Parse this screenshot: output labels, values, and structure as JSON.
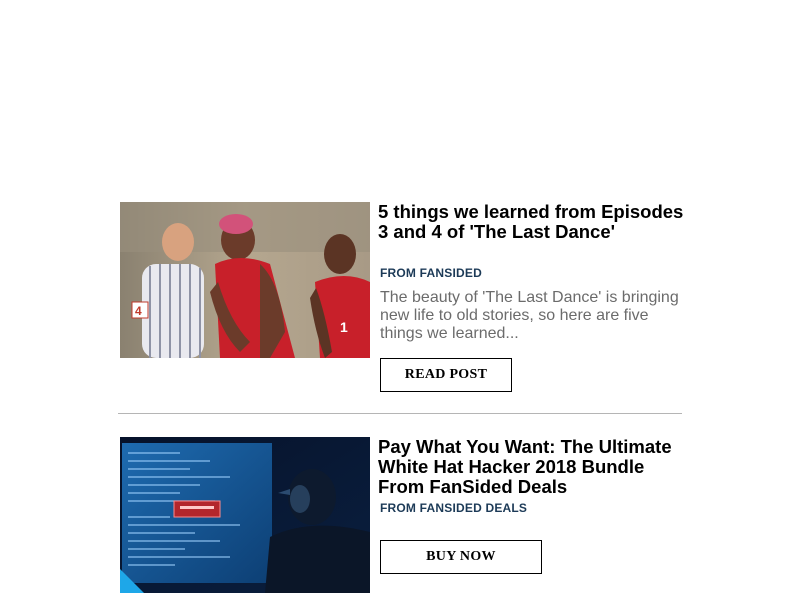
{
  "articles": [
    {
      "title": "5 things we learned from Episodes 3 and 4 of 'The Last Dance'",
      "source": "FROM FANSIDED",
      "excerpt": "The beauty of 'The Last Dance' is bringing new life to old stories, so here are five things we learned...",
      "cta_label": "READ POST",
      "image_alt": "basketball-players-photo"
    },
    {
      "title": "Pay What You Want: The Ultimate White Hat Hacker 2018 Bundle From FanSided Deals",
      "source": "FROM FANSIDED DEALS",
      "cta_label": "BUY NOW",
      "image_alt": "hacker-computer-photo"
    }
  ],
  "colors": {
    "source_text": "#1c3a57",
    "excerpt_text": "#6b6b6b",
    "divider": "#b5b5b5"
  }
}
